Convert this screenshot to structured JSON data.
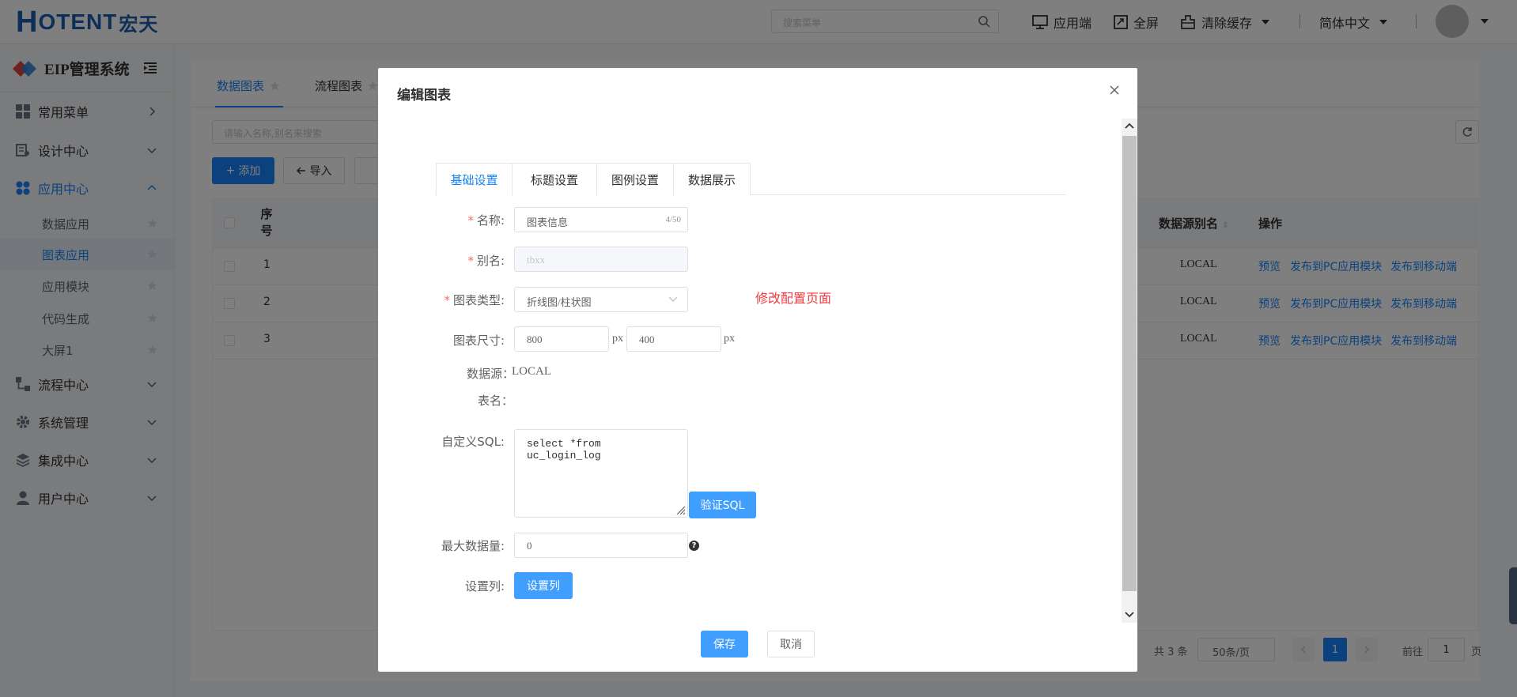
{
  "header": {
    "logo": {
      "H": "H",
      "rest": "OTENT",
      "zh": "宏天"
    },
    "search_placeholder": "搜索菜单",
    "app_label": "应用端",
    "fullscreen_label": "全屏",
    "clear_cache_label": "清除缓存",
    "language_label": "简体中文"
  },
  "sidebar": {
    "system_name": "EIP管理系统",
    "menus": [
      {
        "label": "常用菜单",
        "icon": "grid-icon"
      },
      {
        "label": "设计中心",
        "icon": "design-icon"
      },
      {
        "label": "应用中心",
        "icon": "app-icon"
      },
      {
        "label": "流程中心",
        "icon": "flow-icon"
      },
      {
        "label": "系统管理",
        "icon": "gear-icon"
      },
      {
        "label": "集成中心",
        "icon": "layers-icon"
      },
      {
        "label": "用户中心",
        "icon": "user-icon"
      }
    ],
    "submenus": [
      "数据应用",
      "图表应用",
      "应用模块",
      "代码生成",
      "大屏1"
    ]
  },
  "content": {
    "tabs": [
      "数据图表",
      "流程图表"
    ],
    "filter_placeholder": "请输入名称,别名来搜索",
    "add_label": "添加",
    "import_label": "导入",
    "table": {
      "headers": {
        "index": "序号",
        "datasource": "数据源别名",
        "actions": "操作"
      },
      "rows": [
        {
          "index": "1",
          "datasource": "LOCAL"
        },
        {
          "index": "2",
          "datasource": "LOCAL"
        },
        {
          "index": "3",
          "datasource": "LOCAL"
        }
      ],
      "actions": [
        "预览",
        "发布到PC应用模块",
        "发布到移动端"
      ]
    },
    "pagination": {
      "total": "共 3 条",
      "page_size": "50条/页",
      "current": "1",
      "goto_prefix": "前往",
      "goto_value": "1",
      "goto_suffix": "页"
    }
  },
  "dialog": {
    "title": "编辑图表",
    "tabs": [
      "基础设置",
      "标题设置",
      "图例设置",
      "数据展示"
    ],
    "form": {
      "name_label": "名称:",
      "name_value": "图表信息",
      "name_count": "4/50",
      "alias_label": "别名:",
      "alias_value": "tbxx",
      "type_label": "图表类型:",
      "type_value": "折线图/柱状图",
      "size_label": "图表尺寸:",
      "width_value": "800",
      "height_value": "400",
      "unit": "px",
      "datasource_label": "数据源：",
      "datasource_value": "LOCAL",
      "table_label": "表名：",
      "sql_label": "自定义SQL:",
      "sql_value": "select *from uc_login_log",
      "verify_label": "验证SQL",
      "max_label": "最大数据量:",
      "max_value": "0",
      "columns_label": "设置列:",
      "columns_button": "设置列"
    },
    "note": "修改配置页面",
    "save_label": "保存",
    "cancel_label": "取消"
  }
}
